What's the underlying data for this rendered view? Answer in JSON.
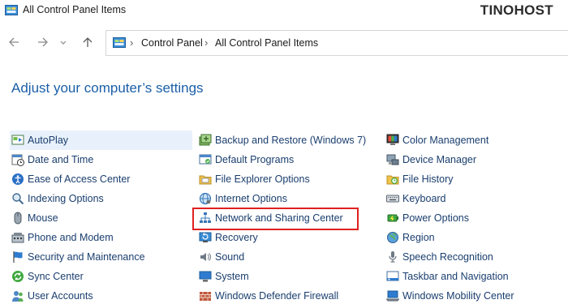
{
  "window": {
    "title": "All Control Panel Items",
    "brand": "TINOHOST"
  },
  "breadcrumb": [
    "Control Panel",
    "All Control Panel Items"
  ],
  "heading": "Adjust your computer’s settings",
  "columns": [
    [
      {
        "label": "AutoPlay",
        "icon": "autoplay-icon"
      },
      {
        "label": "Date and Time",
        "icon": "date-time-icon"
      },
      {
        "label": "Ease of Access Center",
        "icon": "ease-of-access-icon"
      },
      {
        "label": "Indexing Options",
        "icon": "indexing-icon"
      },
      {
        "label": "Mouse",
        "icon": "mouse-icon"
      },
      {
        "label": "Phone and Modem",
        "icon": "phone-modem-icon"
      },
      {
        "label": "Security and Maintenance",
        "icon": "flag-icon"
      },
      {
        "label": "Sync Center",
        "icon": "sync-icon"
      },
      {
        "label": "User Accounts",
        "icon": "user-accounts-icon"
      }
    ],
    [
      {
        "label": "Backup and Restore (Windows 7)",
        "icon": "backup-icon"
      },
      {
        "label": "Default Programs",
        "icon": "default-programs-icon"
      },
      {
        "label": "File Explorer Options",
        "icon": "folder-options-icon"
      },
      {
        "label": "Internet Options",
        "icon": "internet-icon"
      },
      {
        "label": "Network and Sharing Center",
        "icon": "network-icon"
      },
      {
        "label": "Recovery",
        "icon": "recovery-icon"
      },
      {
        "label": "Sound",
        "icon": "speaker-icon"
      },
      {
        "label": "System",
        "icon": "system-icon"
      },
      {
        "label": "Windows Defender Firewall",
        "icon": "firewall-icon"
      }
    ],
    [
      {
        "label": "Color Management",
        "icon": "color-management-icon"
      },
      {
        "label": "Device Manager",
        "icon": "device-manager-icon"
      },
      {
        "label": "File History",
        "icon": "file-history-icon"
      },
      {
        "label": "Keyboard",
        "icon": "keyboard-icon"
      },
      {
        "label": "Power Options",
        "icon": "power-icon"
      },
      {
        "label": "Region",
        "icon": "globe-icon"
      },
      {
        "label": "Speech Recognition",
        "icon": "microphone-icon"
      },
      {
        "label": "Taskbar and Navigation",
        "icon": "taskbar-icon"
      },
      {
        "label": "Windows Mobility Center",
        "icon": "mobility-icon"
      }
    ]
  ],
  "colors": {
    "heading": "#1a5fa8",
    "link": "#1a3e6e",
    "highlight": "#e02020",
    "selected": "#e8f1fb"
  }
}
